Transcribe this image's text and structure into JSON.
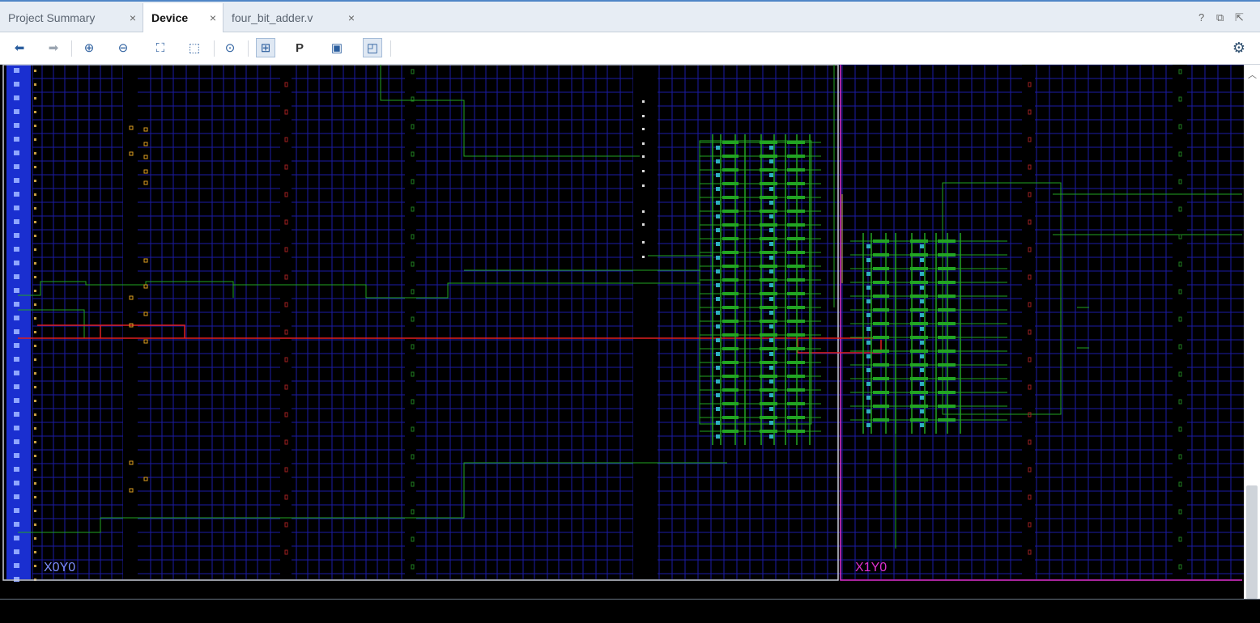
{
  "tabs": [
    {
      "label": "Project Summary",
      "active": false
    },
    {
      "label": "Device",
      "active": true
    },
    {
      "label": "four_bit_adder.v",
      "active": false
    }
  ],
  "tab_close_glyph": "×",
  "window_controls": {
    "help": "?",
    "restore": "⧉",
    "float": "⇱"
  },
  "toolbar": {
    "buttons": [
      {
        "name": "back-icon",
        "glyph": "⬅"
      },
      {
        "name": "forward-icon",
        "glyph": "➡"
      },
      {
        "name": "zoom-in-icon",
        "glyph": "⊕"
      },
      {
        "name": "zoom-out-icon",
        "glyph": "⊖"
      },
      {
        "name": "zoom-fit-icon",
        "glyph": "⛶"
      },
      {
        "name": "zoom-area-icon",
        "glyph": "⬚"
      },
      {
        "name": "auto-fit-selection-icon",
        "glyph": "⊙"
      },
      {
        "name": "routing-resources-icon",
        "glyph": "⊞"
      },
      {
        "name": "pblock-icon",
        "glyph": "P"
      },
      {
        "name": "draw-pblock-icon",
        "glyph": "▣"
      },
      {
        "name": "show-logic-icon",
        "glyph": "◰"
      }
    ],
    "settings_glyph": "⚙"
  },
  "device_view": {
    "regions": [
      {
        "label": "X0Y0",
        "color": "#7f8fff"
      },
      {
        "label": "X1Y0",
        "color": "#e030d0"
      }
    ],
    "colors": {
      "grid": "#1b1ba6",
      "route": "#22a522",
      "selected_net": "#e02020",
      "io_column": "#1a2fd0",
      "cell": "#2fb0c0"
    }
  }
}
